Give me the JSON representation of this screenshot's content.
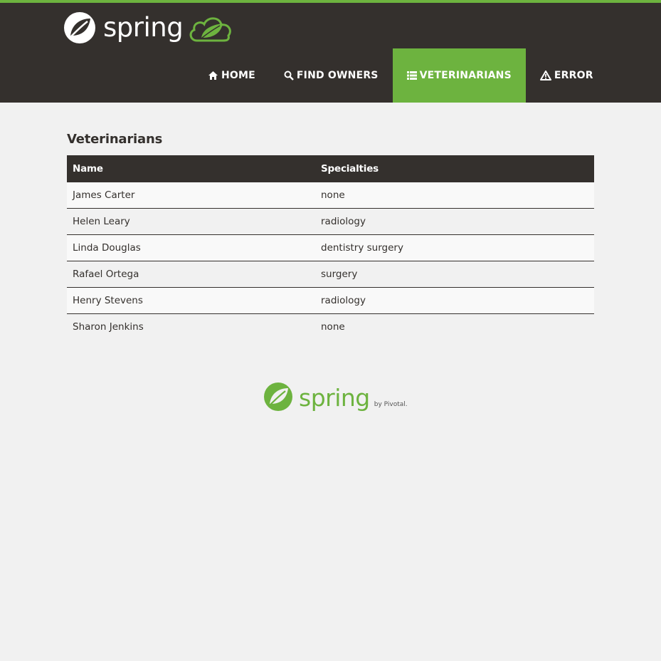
{
  "header": {
    "brand_text": "spring",
    "colors": {
      "bar": "#34302d",
      "accent": "#6db33f"
    }
  },
  "nav": {
    "items": [
      {
        "label": "HOME",
        "icon": "home-icon"
      },
      {
        "label": "FIND OWNERS",
        "icon": "search-icon"
      },
      {
        "label": "VETERINARIANS",
        "icon": "list-icon",
        "active": true
      },
      {
        "label": "ERROR",
        "icon": "warning-icon"
      }
    ]
  },
  "main": {
    "title": "Veterinarians",
    "table": {
      "headers": [
        "Name",
        "Specialties"
      ],
      "rows": [
        [
          "James Carter",
          "none"
        ],
        [
          "Helen Leary",
          "radiology"
        ],
        [
          "Linda Douglas",
          "dentistry surgery"
        ],
        [
          "Rafael Ortega",
          "surgery"
        ],
        [
          "Henry Stevens",
          "radiology"
        ],
        [
          "Sharon Jenkins",
          "none"
        ]
      ]
    }
  },
  "footer": {
    "brand_text": "spring",
    "by_text": "by Pivotal."
  }
}
